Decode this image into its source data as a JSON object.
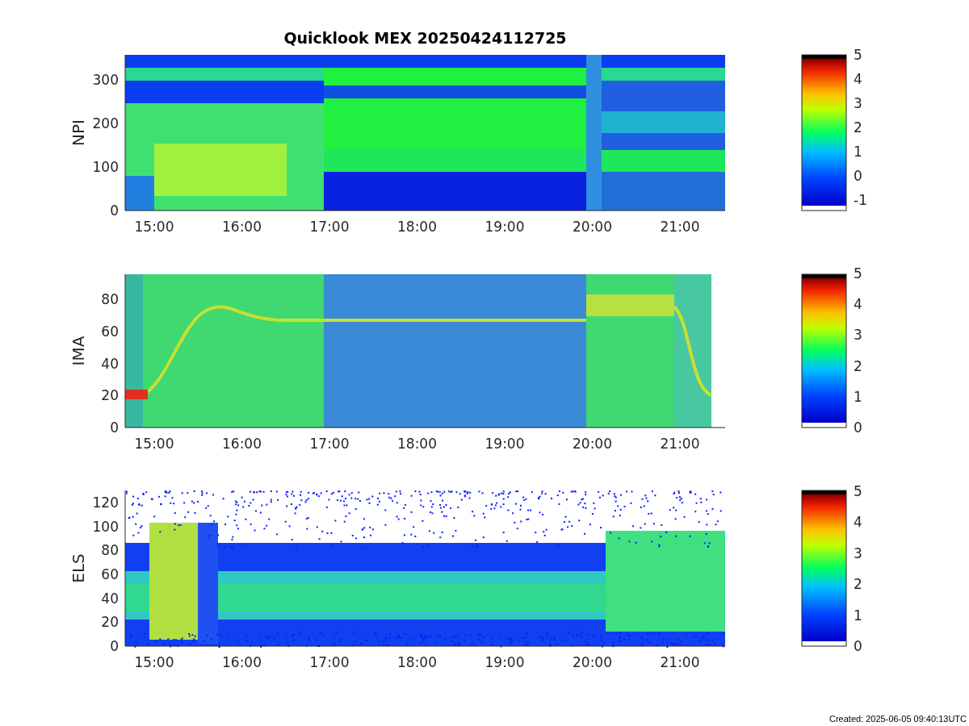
{
  "title": "Quicklook MEX 20250424112725",
  "panels": [
    {
      "ylabel": "NPI",
      "yticks": [
        "300",
        "200",
        "100",
        "0"
      ],
      "xticks": [
        "15:00",
        "16:00",
        "17:00",
        "18:00",
        "19:00",
        "20:00",
        "21:00"
      ],
      "colorbar_ticks": [
        "5",
        "4",
        "3",
        "2",
        "1",
        "0",
        "-1"
      ]
    },
    {
      "ylabel": "IMA",
      "yticks": [
        "80",
        "60",
        "40",
        "20",
        "0"
      ],
      "xticks": [
        "15:00",
        "16:00",
        "17:00",
        "18:00",
        "19:00",
        "20:00",
        "21:00"
      ],
      "colorbar_ticks": [
        "5",
        "4",
        "3",
        "2",
        "1",
        "0"
      ]
    },
    {
      "ylabel": "ELS",
      "yticks": [
        "120",
        "100",
        "80",
        "60",
        "40",
        "20",
        "0"
      ],
      "xticks": [
        "15:00",
        "16:00",
        "17:00",
        "18:00",
        "19:00",
        "20:00",
        "21:00"
      ],
      "colorbar_ticks": [
        "5",
        "4",
        "3",
        "2",
        "1",
        "0"
      ]
    }
  ],
  "footer": "Created: 2025-06-05 09:40:13UTC"
}
